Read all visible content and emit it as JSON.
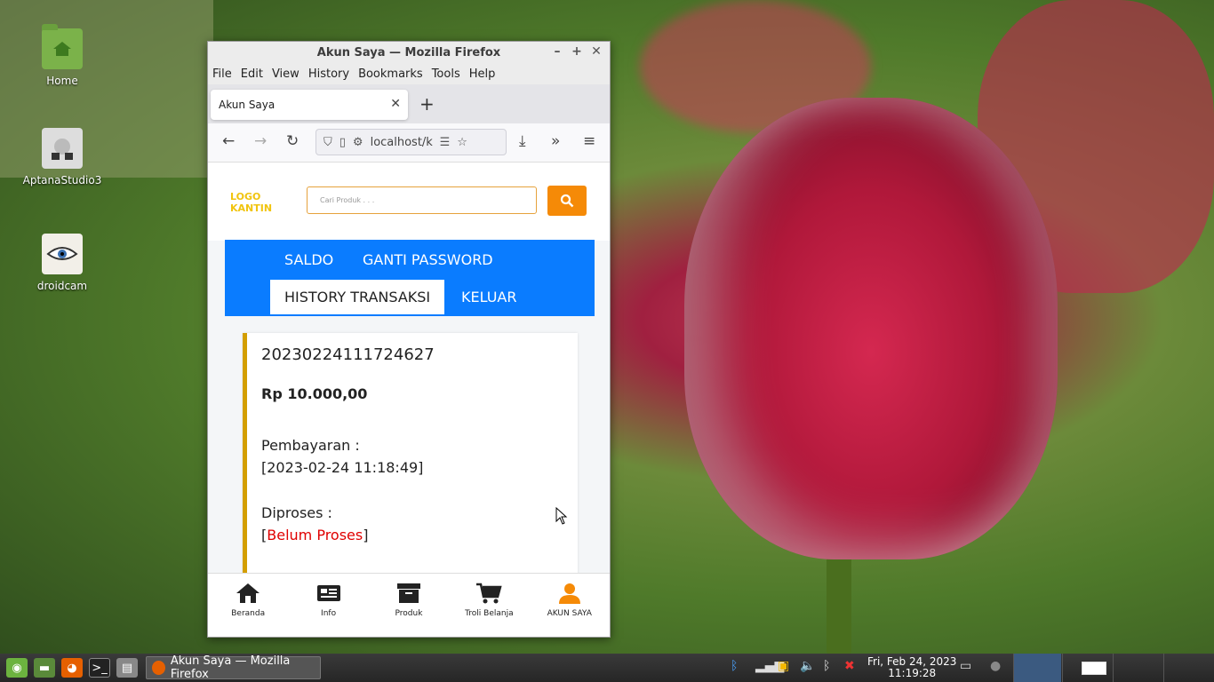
{
  "desktop": {
    "icons": [
      {
        "label": "Home",
        "icon": "folder-home-icon"
      },
      {
        "label": "AptanaStudio3",
        "icon": "aptana-icon"
      },
      {
        "label": "droidcam",
        "icon": "droidcam-icon"
      }
    ]
  },
  "window": {
    "title": "Akun Saya — Mozilla Firefox",
    "menu": [
      "File",
      "Edit",
      "View",
      "History",
      "Bookmarks",
      "Tools",
      "Help"
    ],
    "tab_title": "Akun Saya",
    "url": "localhost/k"
  },
  "site": {
    "logo_line1": "LOGO",
    "logo_line2": "KANTIN",
    "search_placeholder": "Cari Produk . . .",
    "account_tabs": {
      "saldo": "SALDO",
      "ganti_password": "GANTI PASSWORD",
      "history": "HISTORY TRANSAKSI",
      "keluar": "KELUAR"
    },
    "transaction": {
      "code": "20230224111724627",
      "amount": "Rp 10.000,00",
      "payment_label": "Pembayaran :",
      "payment_value": "[2023-02-24 11:18:49]",
      "process_label": "Diproses :",
      "process_open": "[",
      "process_status": "Belum Proses",
      "process_close": "]"
    },
    "bottom_nav": [
      {
        "label": "Beranda",
        "icon": "home-icon"
      },
      {
        "label": "Info",
        "icon": "newspaper-icon"
      },
      {
        "label": "Produk",
        "icon": "archive-box-icon"
      },
      {
        "label": "Troli Belanja",
        "icon": "cart-icon"
      },
      {
        "label": "AKUN SAYA",
        "icon": "user-icon"
      }
    ],
    "accent": "#f58a07",
    "nav_blue": "#0a7cff"
  },
  "taskbar": {
    "task_label": "Akun Saya — Mozilla Firefox",
    "clock_date": "Fri, Feb 24, 2023",
    "clock_time": "11:19:28"
  }
}
